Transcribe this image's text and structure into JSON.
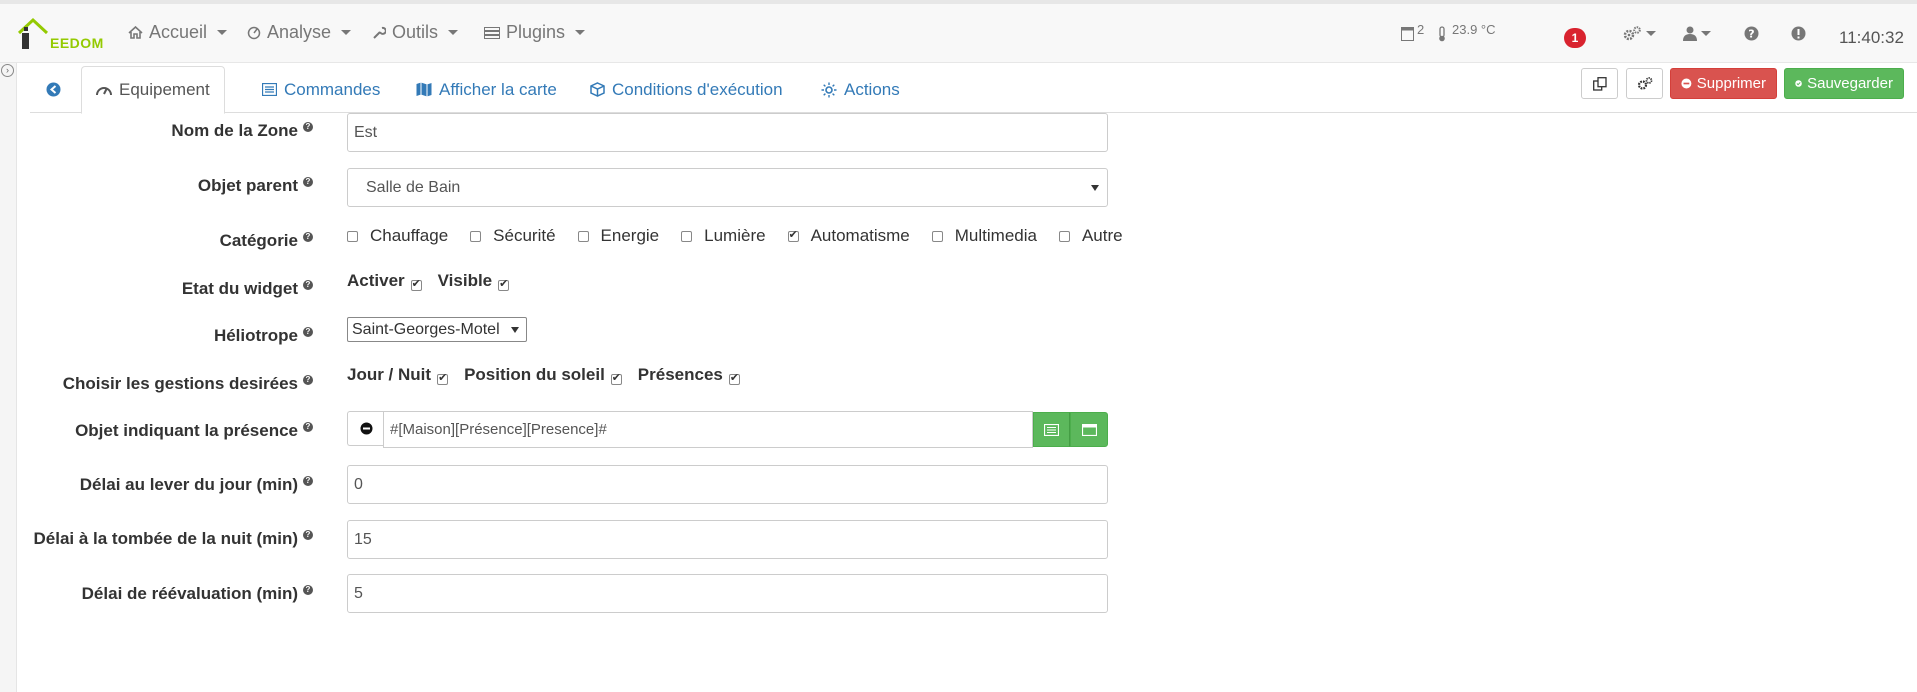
{
  "nav": {
    "logo_text": "EEDOM",
    "menu": [
      {
        "label": "Accueil",
        "icon": "home-icon"
      },
      {
        "label": "Analyse",
        "icon": "analytics-icon"
      },
      {
        "label": "Outils",
        "icon": "wrench-icon"
      },
      {
        "label": "Plugins",
        "icon": "plugins-icon"
      }
    ],
    "status_count": "2",
    "temperature": "23.9 °C",
    "notification_count": "1",
    "clock": "11:40:32"
  },
  "tabs": [
    {
      "label": "Equipement",
      "icon": "dashboard-icon"
    },
    {
      "label": "Commandes",
      "icon": "list-icon"
    },
    {
      "label": "Afficher la carte",
      "icon": "map-icon"
    },
    {
      "label": "Conditions d'exécution",
      "icon": "cube-icon"
    },
    {
      "label": "Actions",
      "icon": "sun-icon"
    }
  ],
  "buttons": {
    "delete": "Supprimer",
    "save": "Sauvegarder"
  },
  "form": {
    "zone_name": {
      "label": "Nom de la Zone",
      "value": "Est"
    },
    "parent": {
      "label": "Objet parent",
      "value": "Salle de Bain"
    },
    "category": {
      "label": "Catégorie",
      "options": [
        {
          "label": "Chauffage",
          "checked": false
        },
        {
          "label": "Sécurité",
          "checked": false
        },
        {
          "label": "Energie",
          "checked": false
        },
        {
          "label": "Lumière",
          "checked": false
        },
        {
          "label": "Automatisme",
          "checked": true
        },
        {
          "label": "Multimedia",
          "checked": false
        },
        {
          "label": "Autre",
          "checked": false
        }
      ]
    },
    "widget_state": {
      "label": "Etat du widget",
      "activate": "Activer",
      "visible": "Visible"
    },
    "heliotrope": {
      "label": "Héliotrope",
      "value": "Saint-Georges-Motel"
    },
    "gestions": {
      "label": "Choisir les gestions desirées",
      "day_night": "Jour / Nuit",
      "sun_position": "Position du soleil",
      "presence": "Présences"
    },
    "presence_object": {
      "label": "Objet indiquant la présence",
      "value": "#[Maison][Présence][Presence]#"
    },
    "delay_sunrise": {
      "label": "Délai au lever du jour (min)",
      "value": "0"
    },
    "delay_nightfall": {
      "label": "Délai à la tombée de la nuit (min)",
      "value": "15"
    },
    "delay_reeval": {
      "label": "Délai de réévaluation (min)",
      "value": "5"
    }
  },
  "colors": {
    "link": "#337ab7",
    "success": "#5cb85c",
    "danger": "#d9534f",
    "badge": "#d9232f",
    "logo_green": "#94ca02"
  }
}
